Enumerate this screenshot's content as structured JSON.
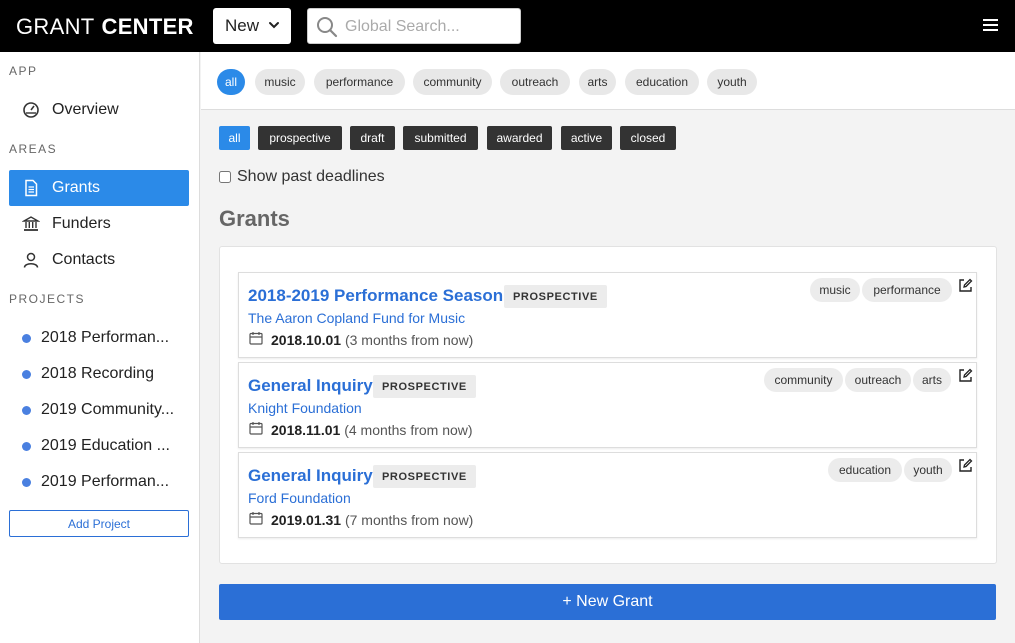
{
  "brand": {
    "light": "GRANT",
    "bold": "CENTER"
  },
  "header": {
    "new_label": "New",
    "search_placeholder": "Global Search...",
    "icons": {
      "search": "search-icon",
      "chevron": "chevron-down-icon",
      "menu": "hamburger-icon"
    }
  },
  "sidebar": {
    "app_label": "APP",
    "areas_label": "AREAS",
    "projects_label": "PROJECTS",
    "app_items": [
      {
        "label": "Overview",
        "icon": "dashboard-icon"
      }
    ],
    "area_items": [
      {
        "label": "Grants",
        "icon": "document-icon",
        "active": true
      },
      {
        "label": "Funders",
        "icon": "bank-icon",
        "active": false
      },
      {
        "label": "Contacts",
        "icon": "user-icon",
        "active": false
      }
    ],
    "projects": [
      {
        "label": "2018 Performan..."
      },
      {
        "label": "2018 Recording"
      },
      {
        "label": "2019 Community..."
      },
      {
        "label": "2019 Education ..."
      },
      {
        "label": "2019 Performan..."
      }
    ],
    "add_project_label": "Add Project"
  },
  "tag_filters": [
    "all",
    "music",
    "performance",
    "community",
    "outreach",
    "arts",
    "education",
    "youth"
  ],
  "status_filters": [
    "all",
    "prospective",
    "draft",
    "submitted",
    "awarded",
    "active",
    "closed"
  ],
  "show_past_label": "Show past deadlines",
  "heading": "Grants",
  "grants": [
    {
      "title": "2018-2019 Performance Season",
      "status": "PROSPECTIVE",
      "funder": "The Aaron Copland Fund for Music",
      "date": "2018.10.01",
      "relative": "(3 months from now)",
      "tags": [
        "music",
        "performance"
      ]
    },
    {
      "title": "General Inquiry",
      "status": "PROSPECTIVE",
      "funder": "Knight Foundation",
      "date": "2018.11.01",
      "relative": "(4 months from now)",
      "tags": [
        "community",
        "outreach",
        "arts"
      ]
    },
    {
      "title": "General Inquiry",
      "status": "PROSPECTIVE",
      "funder": "Ford Foundation",
      "date": "2019.01.31",
      "relative": "(7 months from now)",
      "tags": [
        "education",
        "youth"
      ]
    }
  ],
  "new_grant_label": "+ New Grant",
  "colors": {
    "accent": "#2b8ae8",
    "link": "#2b6fd6",
    "topbar": "#000000",
    "project_dot": "#4a80e0"
  }
}
